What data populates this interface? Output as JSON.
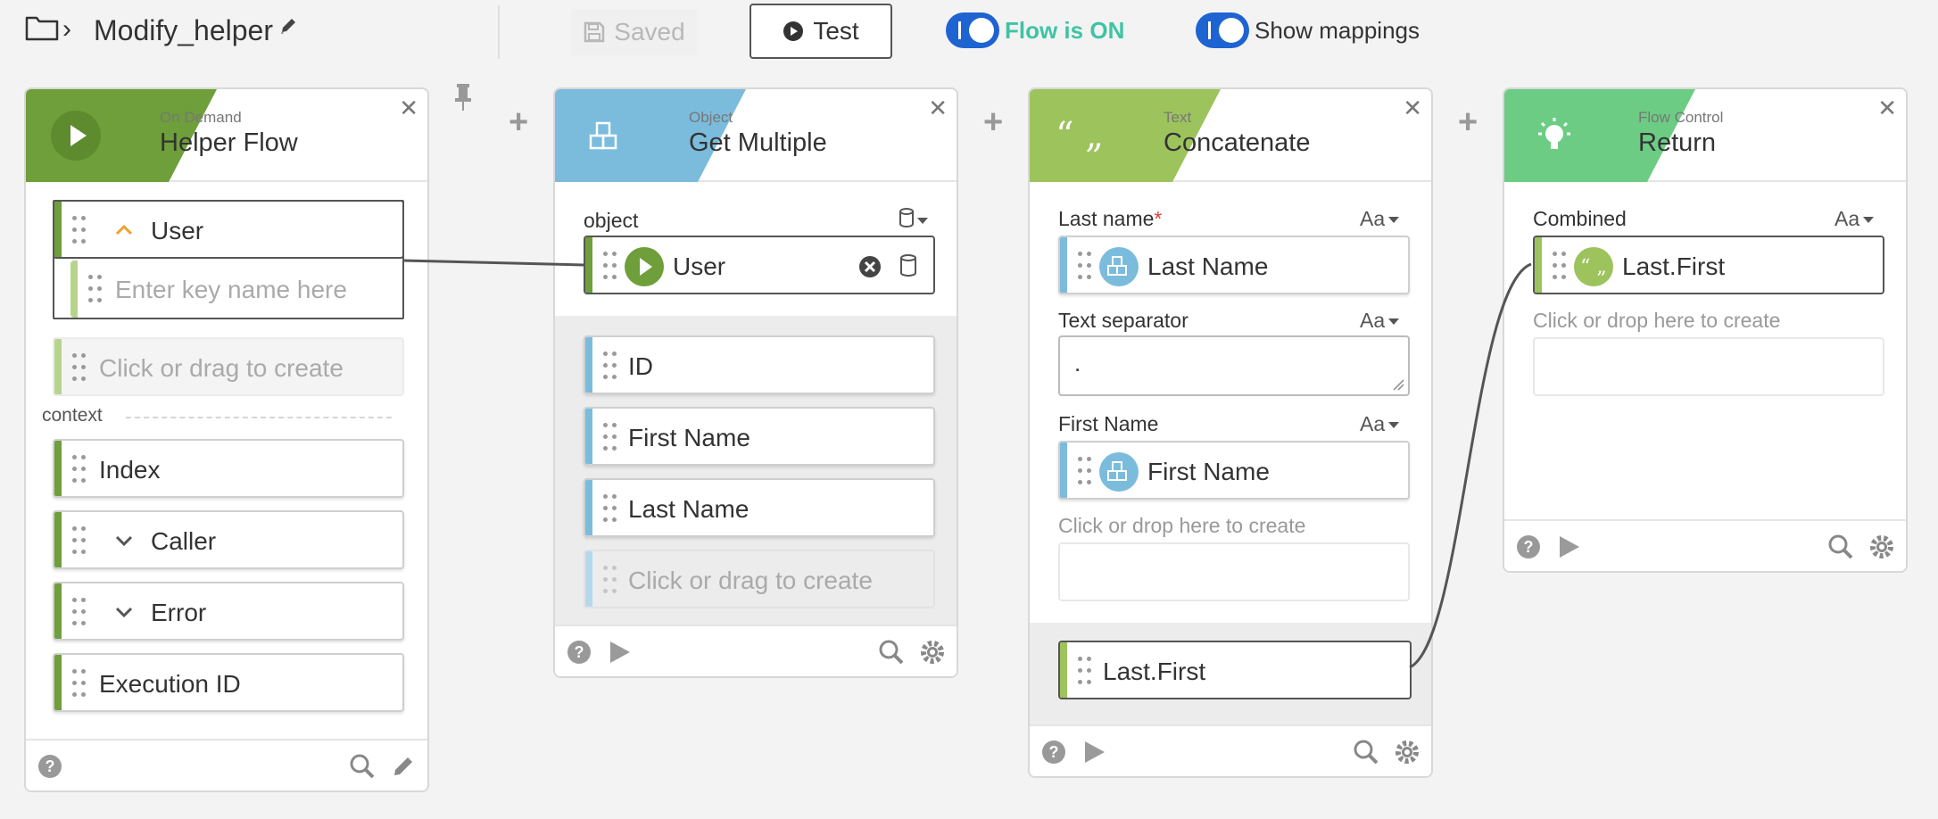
{
  "header": {
    "flow_name": "Modify_helper",
    "saved_label": "Saved",
    "test_label": "Test",
    "flow_status_label": "Flow is ON",
    "show_mappings_label": "Show mappings"
  },
  "colors": {
    "on_demand": "#6e9f3a",
    "object": "#7bbcdd",
    "text": "#9cc35c",
    "flow_control": "#6ccc84",
    "toggle": "#1e63d2",
    "flow_on_text": "#3ec4a4"
  },
  "cards": {
    "helper": {
      "category": "On Demand",
      "name": "Helper Flow",
      "user_label": "User",
      "key_placeholder": "Enter key name here",
      "create_placeholder": "Click or drag to create",
      "context_label": "context",
      "index_label": "Index",
      "caller_label": "Caller",
      "error_label": "Error",
      "execution_id_label": "Execution ID"
    },
    "get_multiple": {
      "category": "Object",
      "name": "Get Multiple",
      "object_label": "object",
      "user_label": "User",
      "id_label": "ID",
      "first_name_label": "First Name",
      "last_name_label": "Last Name",
      "create_placeholder": "Click or drag to create"
    },
    "concatenate": {
      "category": "Text",
      "name": "Concatenate",
      "last_name_field": "Last name",
      "required_mark": "*",
      "last_name_value": "Last Name",
      "separator_field": "Text separator",
      "separator_value": ".",
      "first_name_field": "First Name",
      "first_name_value": "First Name",
      "drop_hint": "Click or drop here to create",
      "output_label": "Last.First",
      "type_label": "Aa"
    },
    "return": {
      "category": "Flow Control",
      "name": "Return",
      "combined_field": "Combined",
      "combined_value": "Last.First",
      "drop_hint": "Click or drop here to create",
      "type_label": "Aa"
    }
  },
  "icons": {
    "folder": "folder-icon",
    "pencil": "pencil-icon",
    "save": "save-icon",
    "play": "play-icon",
    "object": "cube-icon",
    "quote": "quote-icon",
    "bulb": "lightbulb-icon",
    "pin": "pin-icon",
    "search": "search-icon",
    "gear": "gear-icon",
    "help": "help-icon"
  }
}
